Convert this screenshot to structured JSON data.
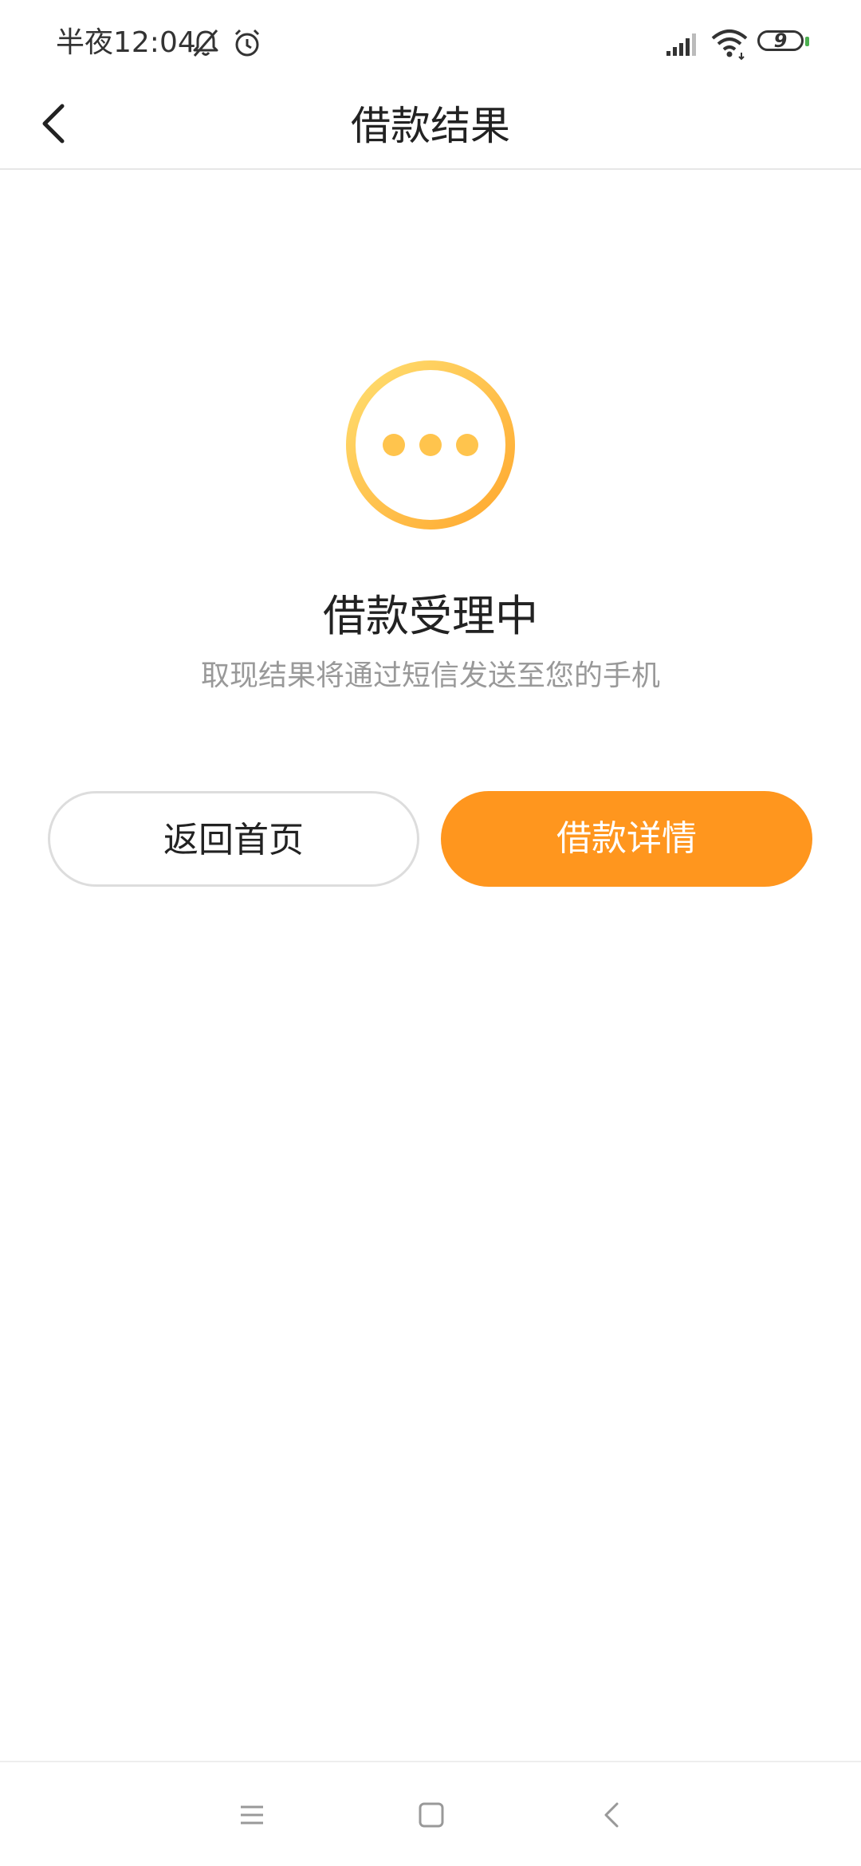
{
  "status_bar": {
    "time": "半夜12:04",
    "icons": [
      "bell-muted-icon",
      "alarm-clock-icon",
      "signal-icon",
      "wifi-icon",
      "battery-icon"
    ],
    "battery_level": "9",
    "battery_accent": "#4caf50"
  },
  "nav": {
    "back_icon": "chevron-left-icon",
    "title": "借款结果"
  },
  "result": {
    "icon": "pending-dots-icon",
    "icon_gradient": [
      "#ffd966",
      "#ffa726"
    ],
    "title": "借款受理中",
    "subtitle": "取现结果将通过短信发送至您的手机"
  },
  "actions": {
    "home_label": "返回首页",
    "detail_label": "借款详情",
    "primary_color": "#ff961e"
  },
  "system_nav": {
    "icons": [
      "menu-icon",
      "home-square-icon",
      "back-chevron-icon"
    ]
  }
}
